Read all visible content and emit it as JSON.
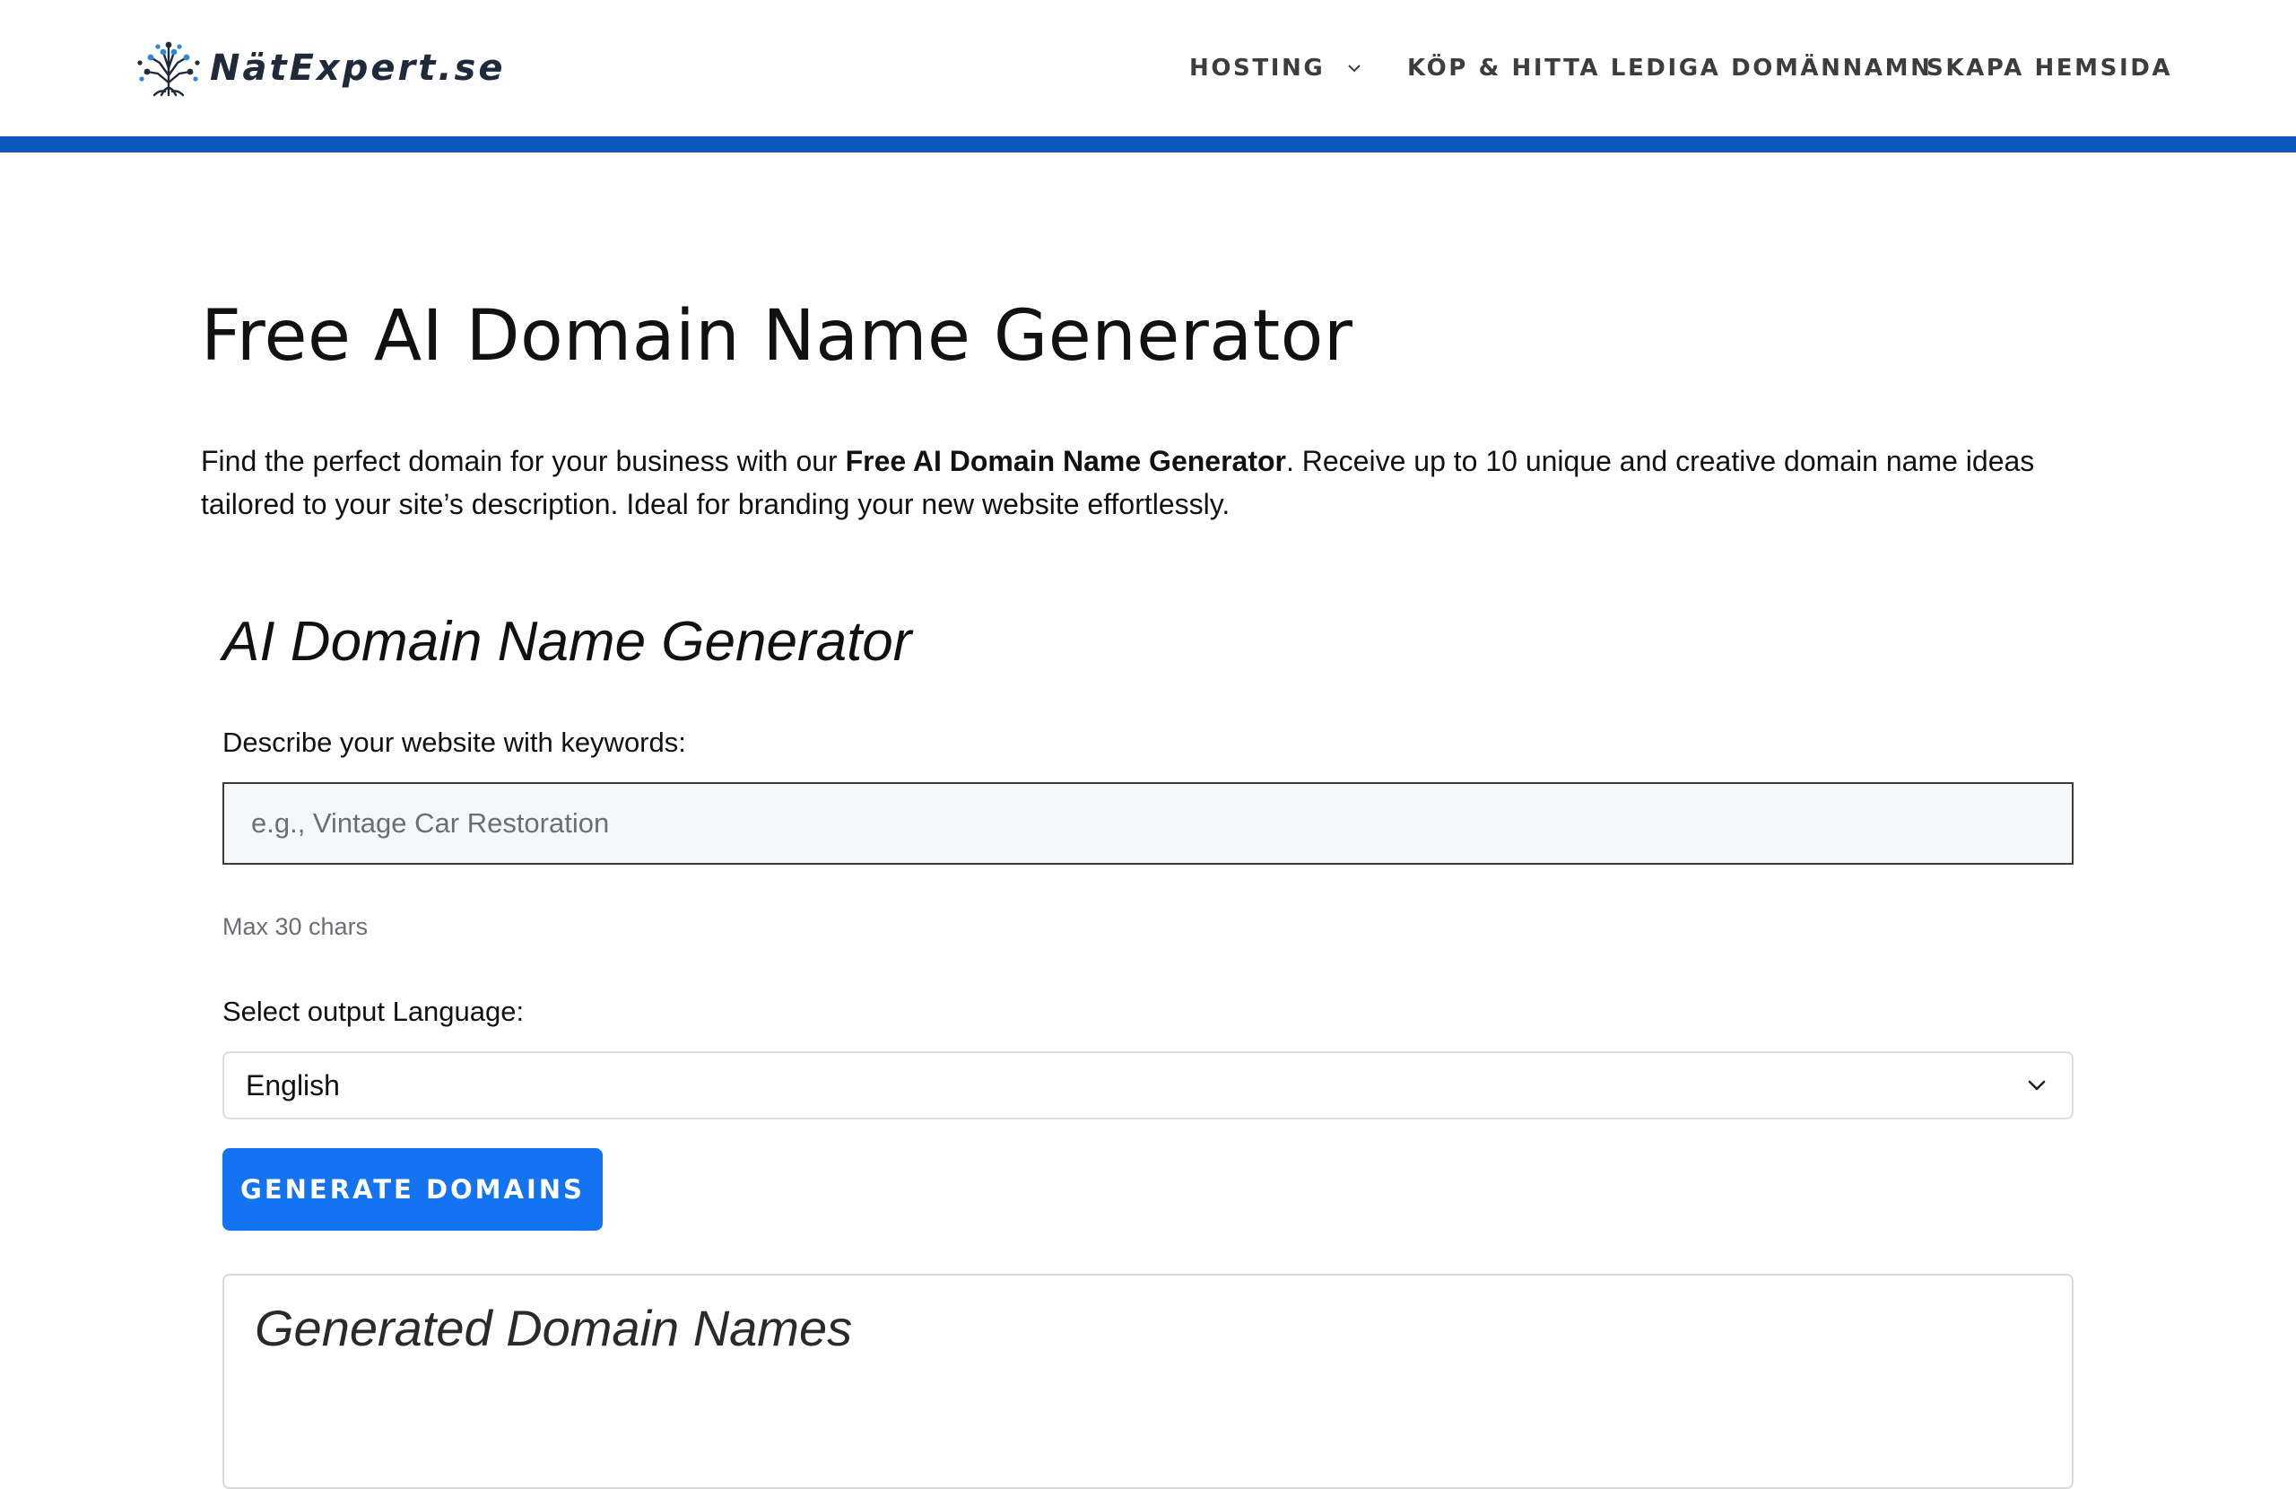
{
  "brand": {
    "logo_text": "NätExpert.se",
    "logo_icon": "tree-circuit-logo",
    "accent_color": "#0b57b7"
  },
  "nav": {
    "items": [
      {
        "label": "HOSTING",
        "has_dropdown": true
      },
      {
        "label": "KÖP & HITTA LEDIGA DOMÄNNAMN",
        "has_dropdown": false
      },
      {
        "label": "SKAPA HEMSIDA",
        "has_dropdown": false
      }
    ]
  },
  "main": {
    "title": "Free AI Domain Name Generator",
    "intro_before": "Find the perfect domain for your business with our ",
    "intro_bold": "Free AI Domain Name Generator",
    "intro_after": ". Receive up to 10 unique and creative domain name ideas tailored to your site’s description. Ideal for branding your new website effortlessly."
  },
  "generator": {
    "title": "AI Domain Name Generator",
    "keywords_label": "Describe your website with keywords:",
    "keywords_placeholder": "e.g., Vintage Car Restoration",
    "keywords_value": "",
    "keywords_hint": "Max 30 chars",
    "language_label": "Select output Language:",
    "language_selected": "English",
    "generate_label": "Generate Domains",
    "button_color": "#1473f0"
  },
  "results": {
    "title": "Generated Domain Names"
  }
}
